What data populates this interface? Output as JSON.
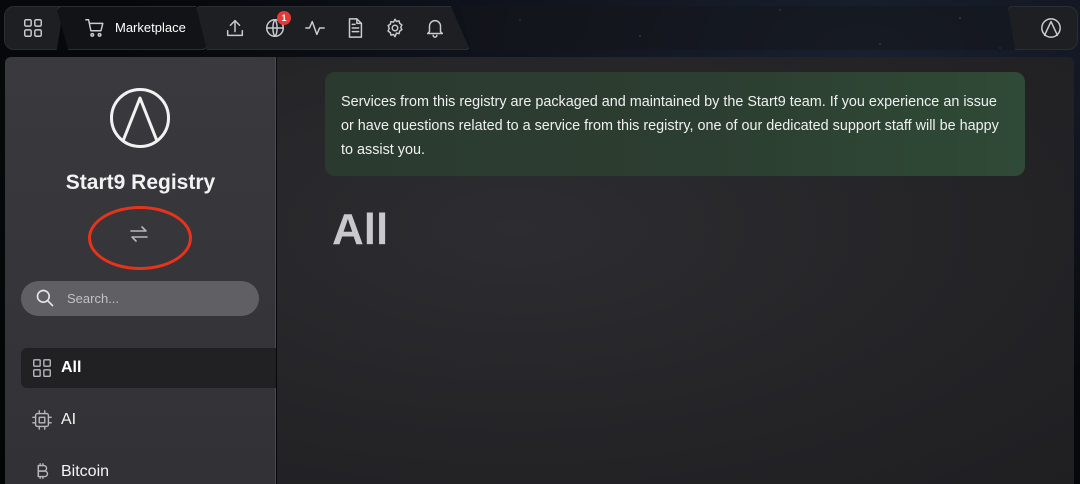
{
  "topbar": {
    "marketplace_label": "Marketplace",
    "notification_count": "1",
    "icons": [
      "apps-grid-icon",
      "cart-icon",
      "upload-icon",
      "globe-icon",
      "activity-icon",
      "document-icon",
      "gear-icon",
      "bell-icon",
      "start9-logo-icon"
    ]
  },
  "sidebar": {
    "registry_name": "Start9 Registry",
    "search": {
      "placeholder": "Search...",
      "value": ""
    },
    "categories": [
      {
        "label": "All",
        "icon": "grid-icon",
        "active": true
      },
      {
        "label": "AI",
        "icon": "chip-icon",
        "active": false
      },
      {
        "label": "Bitcoin",
        "icon": "bitcoin-icon",
        "active": false
      }
    ]
  },
  "main": {
    "notice": "Services from this registry are packaged and maintained by the Start9 team. If you experience an issue or have questions related to a service from this registry, one of our dedicated support staff will be happy to assist you.",
    "heading": "All"
  },
  "colors": {
    "highlight_ring": "#e8331c",
    "badge": "#e53935",
    "notice_bg": "#2c3e31"
  }
}
